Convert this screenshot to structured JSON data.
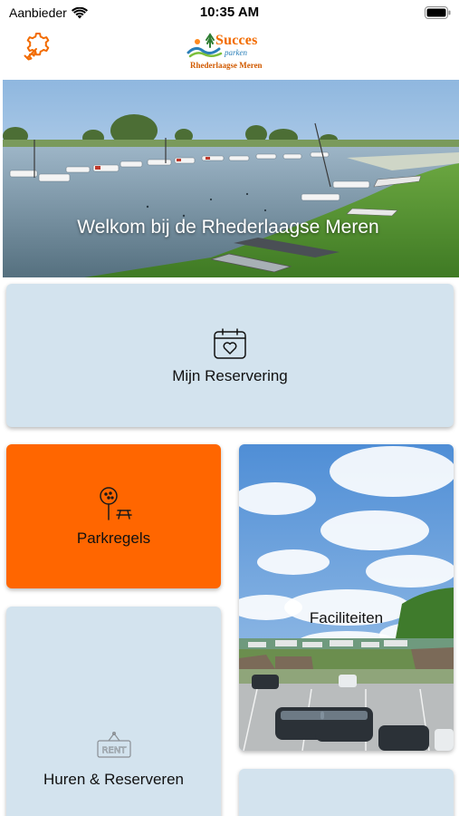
{
  "status_bar": {
    "carrier": "Aanbieder",
    "time": "10:35 AM"
  },
  "header": {
    "settings_icon": "settings-wrench-gear-icon",
    "logo": {
      "brand": "Succes",
      "sub": "parken",
      "park": "Rhederlaagse Meren"
    }
  },
  "hero": {
    "title": "Welkom bij de Rhederlaagse Meren"
  },
  "tiles": {
    "reservation": {
      "label": "Mijn Reservering",
      "icon": "calendar-heart-icon"
    },
    "park_rules": {
      "label": "Parkregels",
      "icon": "sign-picnic-table-icon"
    },
    "facilities": {
      "label": "Faciliteiten"
    },
    "rent": {
      "label": "Huren & Reserveren",
      "icon": "rent-sign-icon"
    }
  },
  "colors": {
    "accent": "#ff6600",
    "tile_light": "#d3e3ee"
  }
}
